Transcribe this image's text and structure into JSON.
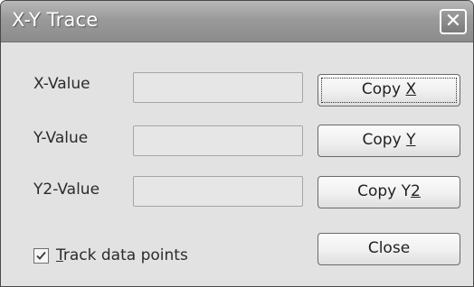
{
  "window": {
    "title": "X-Y Trace",
    "close_glyph": "✕"
  },
  "rows": [
    {
      "label": "X-Value",
      "value": "",
      "button_prefix": "Copy ",
      "button_accel": "X"
    },
    {
      "label": "Y-Value",
      "value": "",
      "button_prefix": "Copy ",
      "button_accel": "Y"
    },
    {
      "label": "Y2-Value",
      "value": "",
      "button_prefix": "Copy Y",
      "button_accel": "2"
    }
  ],
  "track": {
    "checked": true,
    "accel": "T",
    "label_rest": "rack data points"
  },
  "close_button": {
    "label": "Close"
  }
}
